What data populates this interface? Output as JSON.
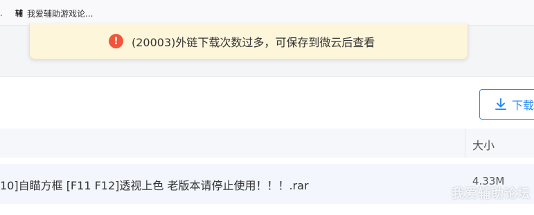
{
  "bookmarks": {
    "leading_mark": ".",
    "items": [
      {
        "icon": "辅",
        "label": "我爱辅助游戏论..."
      }
    ]
  },
  "toast": {
    "icon": "!",
    "message": "(20003)外链下载次数过多，可保存到微云后查看"
  },
  "toolbar": {
    "download_label": "下载"
  },
  "table": {
    "columns": {
      "size": "大小"
    },
    "rows": [
      {
        "name": "10]自瞄方框 [F11 F12]透视上色 老版本请停止使用！！！.rar",
        "size": "4.33M"
      }
    ]
  },
  "watermark": "我爱辅助论坛",
  "colors": {
    "accent": "#2d8cf0",
    "toast_bg": "#fdf6db",
    "error": "#f0563a"
  }
}
